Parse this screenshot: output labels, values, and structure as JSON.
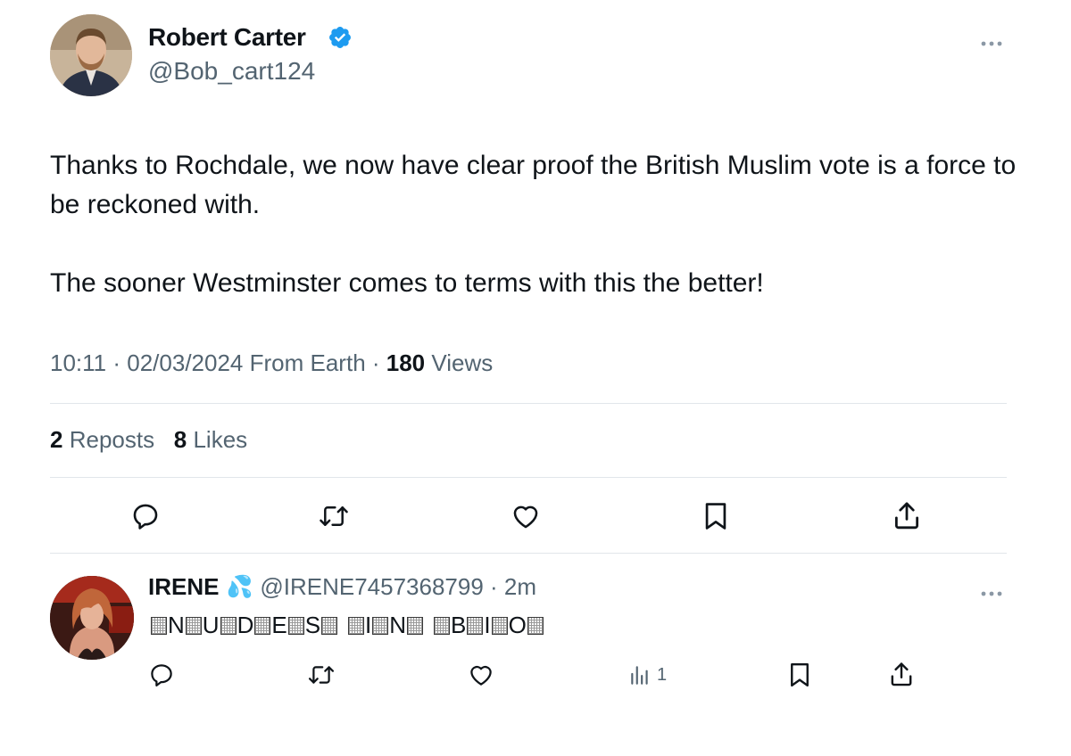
{
  "tweet": {
    "author_name": "Robert Carter",
    "author_handle": "@Bob_cart124",
    "verified": true,
    "text_paragraphs": [
      "Thanks to Rochdale, we now have clear proof the British Muslim vote is a force to be reckoned with.",
      "The sooner Westminster comes to terms with this the better!"
    ],
    "time": "10:11",
    "date": "02/03/2024",
    "source": "From Earth",
    "views_count": "180",
    "views_label": "Views",
    "reposts_count": "2",
    "reposts_label": "Reposts",
    "likes_count": "8",
    "likes_label": "Likes",
    "actions": [
      "reply-icon",
      "repost-icon",
      "like-icon",
      "bookmark-icon",
      "share-icon"
    ]
  },
  "reply": {
    "author_name": "IRENE",
    "emoji": "💦",
    "author_handle": "@IRENE7457368799",
    "time": "2m",
    "text": "▒N▒U▒D▒E▒S▒ ▒I▒N▒ ▒B▒I▒O▒",
    "views_count": "1",
    "actions": [
      "reply-icon",
      "repost-icon",
      "like-icon",
      "views-icon",
      "bookmark-icon",
      "share-icon"
    ]
  },
  "colors": {
    "text_primary": "#0f1419",
    "text_secondary": "#536471",
    "verified_blue": "#1d9bf0",
    "divider": "#e1e6ea"
  }
}
